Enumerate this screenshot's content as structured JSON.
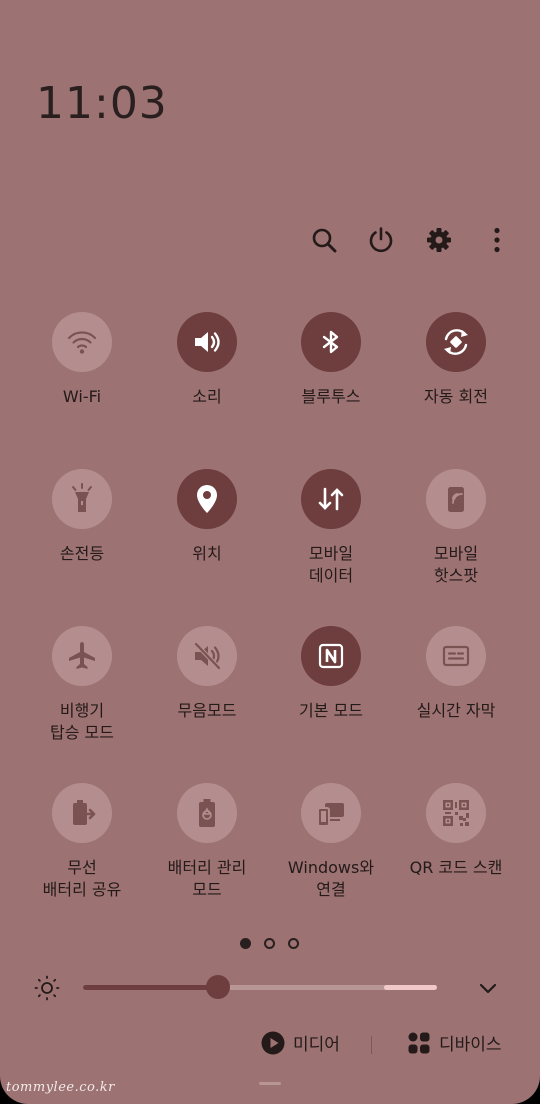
{
  "clock": "11:03",
  "topbar": {
    "icons": [
      "search-icon",
      "power-icon",
      "settings-icon",
      "more-vert-icon"
    ]
  },
  "tiles": [
    {
      "label": "Wi-Fi",
      "icon": "wifi-icon",
      "state": "off"
    },
    {
      "label": "소리",
      "icon": "sound-icon",
      "state": "on"
    },
    {
      "label": "블루투스",
      "icon": "bluetooth-icon",
      "state": "on"
    },
    {
      "label": "자동 회전",
      "icon": "auto-rotate-icon",
      "state": "on"
    },
    {
      "label": "손전등",
      "icon": "flashlight-icon",
      "state": "off"
    },
    {
      "label": "위치",
      "icon": "location-icon",
      "state": "on"
    },
    {
      "label": "모바일\n데이터",
      "icon": "mobile-data-icon",
      "state": "on"
    },
    {
      "label": "모바일\n핫스팟",
      "icon": "hotspot-icon",
      "state": "off"
    },
    {
      "label": "비행기\n탑승 모드",
      "icon": "airplane-icon",
      "state": "off"
    },
    {
      "label": "무음모드",
      "icon": "mute-icon",
      "state": "off"
    },
    {
      "label": "기본 모드",
      "icon": "nfc-icon",
      "state": "on"
    },
    {
      "label": "실시간 자막",
      "icon": "live-caption-icon",
      "state": "off"
    },
    {
      "label": "무선\n배터리 공유",
      "icon": "wireless-powershare-icon",
      "state": "off"
    },
    {
      "label": "배터리 관리\n모드",
      "icon": "battery-saver-icon",
      "state": "off"
    },
    {
      "label": "Windows와\n연결",
      "icon": "link-to-windows-icon",
      "state": "off"
    },
    {
      "label": "QR 코드 스캔",
      "icon": "qr-scan-icon",
      "state": "off"
    }
  ],
  "pagination": {
    "pages": 3,
    "current": 1
  },
  "brightness": {
    "level": 0.38,
    "extra_brightness_level": 0.85
  },
  "bottom": {
    "media_label": "미디어",
    "devices_label": "디바이스"
  },
  "watermark": "tommylee.co.kr",
  "colors": {
    "background": "#9c7272",
    "tile_on": "#6e3d3d",
    "tile_off": "#b48e8e",
    "text": "#241a1a"
  }
}
